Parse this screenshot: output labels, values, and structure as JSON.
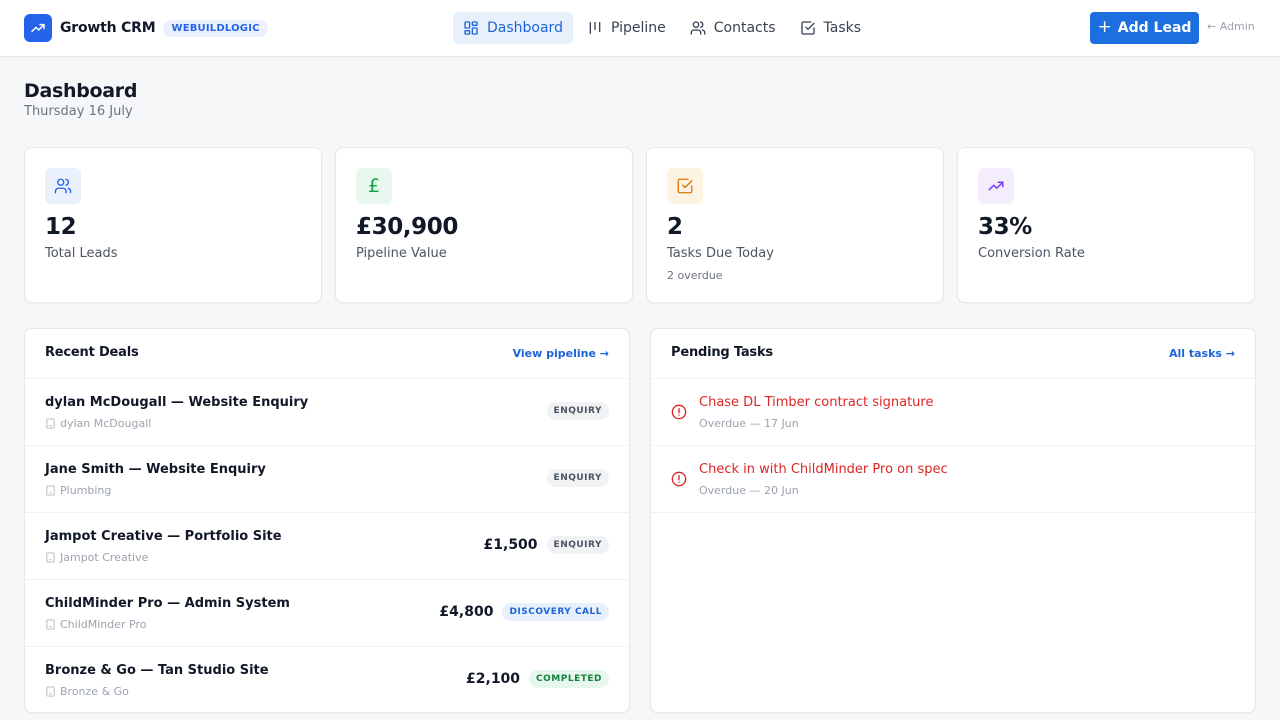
{
  "header": {
    "brand_name": "Growth CRM",
    "brand_badge": "WEBUILDLOGIC",
    "nav": [
      {
        "label": "Dashboard",
        "icon": "dashboard-icon",
        "active": true
      },
      {
        "label": "Pipeline",
        "icon": "pipeline-icon",
        "active": false
      },
      {
        "label": "Contacts",
        "icon": "contacts-icon",
        "active": false
      },
      {
        "label": "Tasks",
        "icon": "tasks-icon",
        "active": false
      }
    ],
    "add_lead_label": "Add Lead",
    "admin_label": "← Admin"
  },
  "page": {
    "title": "Dashboard",
    "date": "Thursday 16 July"
  },
  "stats": [
    {
      "value": "12",
      "label": "Total Leads",
      "sub": "",
      "icon": "users-icon",
      "color": "#2563eb",
      "bg": "#eaf1fd"
    },
    {
      "value": "£30,900",
      "label": "Pipeline Value",
      "sub": "",
      "icon": "pound-icon",
      "color": "#16a34a",
      "bg": "#e9f8ef"
    },
    {
      "value": "2",
      "label": "Tasks Due Today",
      "sub": "2 overdue",
      "icon": "check-square-icon",
      "color": "#d97706",
      "bg": "#fdf3e2"
    },
    {
      "value": "33%",
      "label": "Conversion Rate",
      "sub": "",
      "icon": "trending-up-icon",
      "color": "#7c3aed",
      "bg": "#f3edfd"
    }
  ],
  "recent_deals": {
    "title": "Recent Deals",
    "link": "View pipeline",
    "rows": [
      {
        "title": "dylan McDougall — Website Enquiry",
        "company": "dylan McDougall",
        "value": "",
        "stage": "ENQUIRY",
        "stage_type": "enquiry"
      },
      {
        "title": "Jane Smith — Website Enquiry",
        "company": "Plumbing",
        "value": "",
        "stage": "ENQUIRY",
        "stage_type": "enquiry"
      },
      {
        "title": "Jampot Creative — Portfolio Site",
        "company": "Jampot Creative",
        "value": "£1,500",
        "stage": "ENQUIRY",
        "stage_type": "enquiry"
      },
      {
        "title": "ChildMinder Pro — Admin System",
        "company": "ChildMinder Pro",
        "value": "£4,800",
        "stage": "DISCOVERY CALL",
        "stage_type": "discovery"
      },
      {
        "title": "Bronze & Go — Tan Studio Site",
        "company": "Bronze & Go",
        "value": "£2,100",
        "stage": "COMPLETED",
        "stage_type": "completed"
      }
    ]
  },
  "pending_tasks": {
    "title": "Pending Tasks",
    "link": "All tasks",
    "rows": [
      {
        "title": "Chase DL Timber contract signature",
        "due": "Overdue — 17 Jun"
      },
      {
        "title": "Check in with ChildMinder Pro on spec",
        "due": "Overdue — 20 Jun"
      }
    ]
  },
  "colors": {
    "accent": "#1d6fe0",
    "overdue": "#dc2626"
  }
}
